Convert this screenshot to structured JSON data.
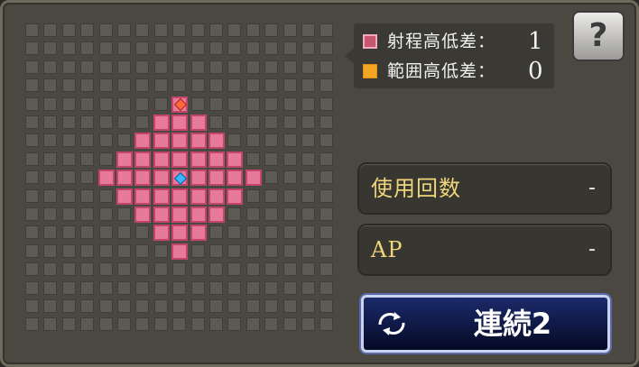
{
  "legend": {
    "range_height_label": "射程高低差：",
    "range_height_value": "1",
    "area_height_label": "範囲高低差：",
    "area_height_value": "0"
  },
  "help_button": {
    "label": "?"
  },
  "stats": [
    {
      "label": "使用回数",
      "value": "-"
    },
    {
      "label": "AP",
      "value": "-"
    }
  ],
  "chain_button": {
    "label": "連続2"
  },
  "grid": {
    "rows": 17,
    "cols": 17,
    "range_rows": [
      {
        "row": 4,
        "from": 8,
        "to": 8
      },
      {
        "row": 5,
        "from": 7,
        "to": 9
      },
      {
        "row": 6,
        "from": 6,
        "to": 10
      },
      {
        "row": 7,
        "from": 5,
        "to": 11
      },
      {
        "row": 8,
        "from": 4,
        "to": 12
      },
      {
        "row": 9,
        "from": 5,
        "to": 11
      },
      {
        "row": 10,
        "from": 6,
        "to": 10
      },
      {
        "row": 11,
        "from": 7,
        "to": 9
      },
      {
        "row": 12,
        "from": 8,
        "to": 8
      }
    ],
    "caster": {
      "row": 8,
      "col": 8
    },
    "target": {
      "row": 4,
      "col": 8
    }
  },
  "colors": {
    "range_fill": "#e77a9b",
    "range_border": "#c3456c",
    "caster": "#3ab6ff",
    "target": "#ff6a3a",
    "stat_label": "#f0d67a"
  }
}
